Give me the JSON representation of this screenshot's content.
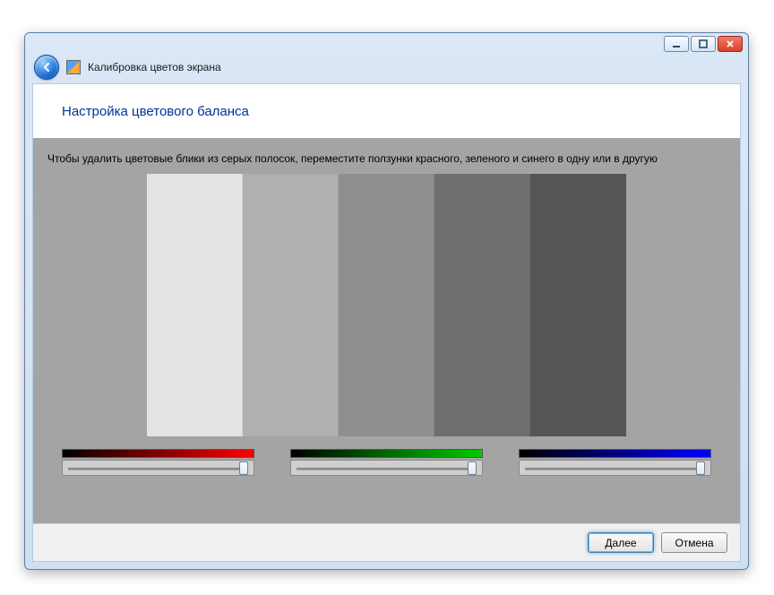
{
  "window": {
    "title": "Калибровка цветов экрана"
  },
  "page": {
    "heading": "Настройка цветового баланса",
    "instruction": "Чтобы удалить цветовые блики из серых полосок, переместите ползунки красного, зеленого и синего в одну или в другую"
  },
  "gray_bars": {
    "colors": [
      "#e4e4e4",
      "#b0b0b0",
      "#8f8f8f",
      "#6f6f6f",
      "#555555"
    ]
  },
  "sliders": {
    "red": {
      "name": "red-slider",
      "value": 95
    },
    "green": {
      "name": "green-slider",
      "value": 95
    },
    "blue": {
      "name": "blue-slider",
      "value": 95
    }
  },
  "footer": {
    "next": "Далее",
    "cancel": "Отмена"
  }
}
